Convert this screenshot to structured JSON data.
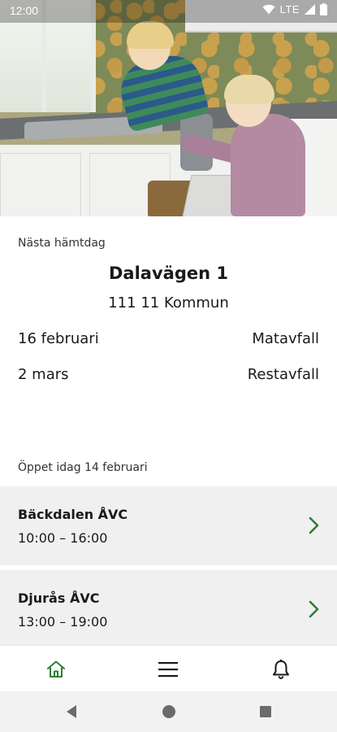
{
  "status_bar": {
    "time": "12:00",
    "network": "LTE"
  },
  "next_pickup": {
    "label": "Nästa hämtdag",
    "address": "Dalavägen 1",
    "city": "111 11 Kommun",
    "rows": [
      {
        "date": "16 februari",
        "type": "Matavfall"
      },
      {
        "date": "2 mars",
        "type": "Restavfall"
      }
    ]
  },
  "open_today": {
    "label": "Öppet idag 14 februari",
    "centers": [
      {
        "name": "Bäckdalen ÅVC",
        "hours": "10:00 – 16:00"
      },
      {
        "name": "Djurås ÅVC",
        "hours": "13:00 – 19:00"
      }
    ]
  },
  "bottom_nav": {
    "items": [
      {
        "icon": "home-icon",
        "active": true
      },
      {
        "icon": "menu-icon",
        "active": false
      },
      {
        "icon": "bell-icon",
        "active": false
      }
    ]
  },
  "colors": {
    "accent": "#2e7d32",
    "card_background": "#f0f0f0",
    "system_bar": "#f2f2f2"
  }
}
